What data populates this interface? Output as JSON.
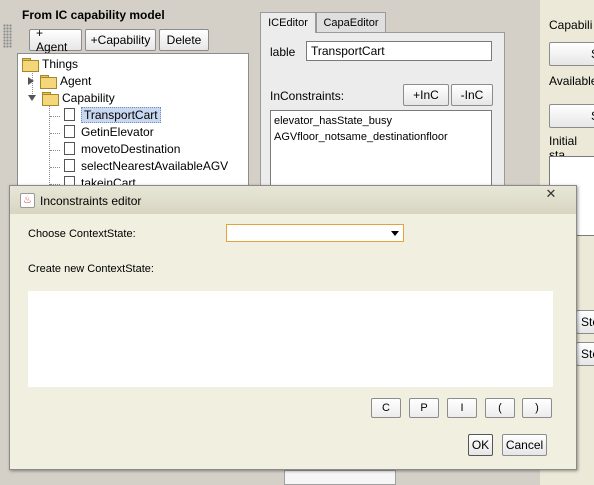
{
  "left_panel": {
    "title": "From IC capability model",
    "toolbar": {
      "add_agent": "+ Agent",
      "add_capability": "+Capability",
      "delete": "Delete"
    },
    "tree": {
      "root": "Things",
      "agent": "Agent",
      "capability": "Capability",
      "items": [
        "TransportCart",
        "GetinElevator",
        "movetoDestination",
        "selectNearestAvailableAGV",
        "takeinCart"
      ],
      "selected": "TransportCart"
    }
  },
  "tabs": [
    "ICEditor",
    "CapaEditor"
  ],
  "ic_editor": {
    "label_caption": "lable",
    "label_value": "TransportCart",
    "inconstraints_caption": "InConstraints:",
    "add_button": "+InC",
    "remove_button": "-InC",
    "constraints": [
      "elevator_hasState_busy",
      "AGVfloor_notsame_destinationfloor"
    ]
  },
  "right_panel": {
    "capability_label": "Capabili",
    "available_label": "Available",
    "initial_label": "Initial sta",
    "button1": "S",
    "button2": "S",
    "button3": "Ste",
    "button4": "Ste"
  },
  "dialog": {
    "title": "Inconstraints editor",
    "close_icon": "close-icon",
    "choose_label": "Choose ContextState:",
    "choose_value": "",
    "create_label": "Create new ContextState:",
    "text_value": "",
    "operator_buttons": [
      "C",
      "P",
      "I",
      "(",
      ")"
    ],
    "ok": "OK",
    "cancel": "Cancel"
  },
  "colors": {
    "selection": "#c8d8f0",
    "combo_focus": "#e5a13b",
    "dialog_bg": "#f0efe0"
  }
}
